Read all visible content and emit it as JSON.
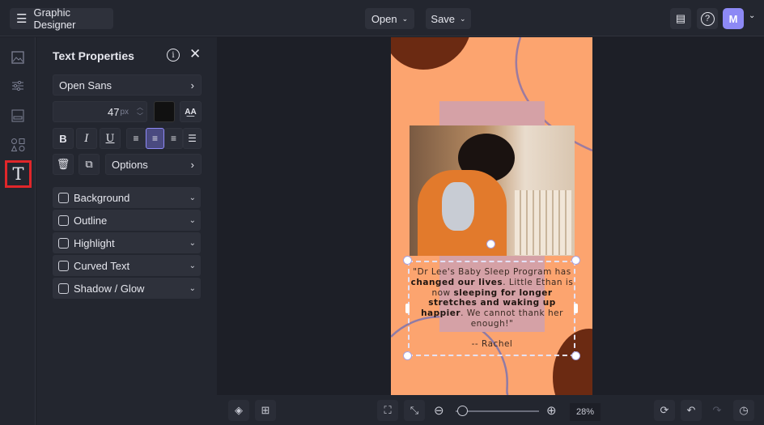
{
  "app": {
    "title": "Graphic Designer",
    "open_label": "Open",
    "save_label": "Save",
    "avatar_initial": "M"
  },
  "panel": {
    "title": "Text Properties",
    "font": "Open Sans",
    "font_size": "47",
    "font_size_unit": "px",
    "text_color": "#111111",
    "options_label": "Options",
    "effects": [
      {
        "label": "Background"
      },
      {
        "label": "Outline"
      },
      {
        "label": "Highlight"
      },
      {
        "label": "Curved Text"
      },
      {
        "label": "Shadow / Glow"
      }
    ]
  },
  "rail": {
    "active": "text"
  },
  "artboard": {
    "quote_p1": "\"Dr Lee's Baby Sleep Program has ",
    "quote_b1": "changed our lives",
    "quote_p2": ". Little Ethan is now ",
    "quote_b2": "sleeping for longer stretches and waking up happier",
    "quote_p3": ". We cannot thank her enough!\"",
    "signature": "-- Rachel"
  },
  "zoom": {
    "level": "28%",
    "value": 28
  },
  "colors": {
    "accent": "#8d89f5",
    "highlight": "#e0262a",
    "artboard": "#fca46f",
    "brown": "#6b2a12"
  }
}
